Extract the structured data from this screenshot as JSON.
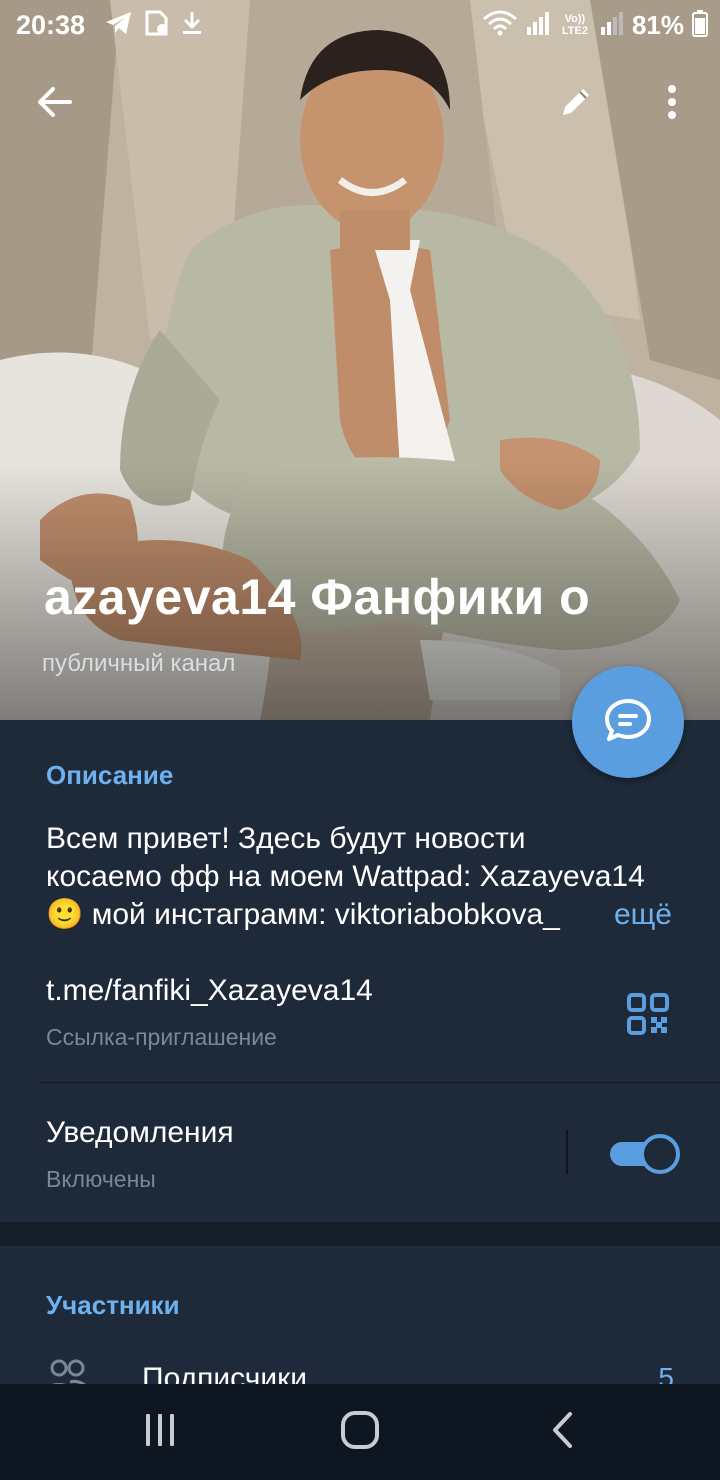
{
  "status_bar": {
    "time": "20:38",
    "battery": "81%",
    "icons_left": [
      "telegram-icon",
      "sim-card-icon",
      "download-icon"
    ],
    "icons_right": [
      "wifi-icon",
      "volte-signal-icon",
      "signal-icon",
      "battery-icon"
    ],
    "volte_label": "Vo)) LTE2"
  },
  "toolbar": {
    "back_icon": "arrow-left-icon",
    "edit_icon": "pencil-icon",
    "more_icon": "dots-vertical-icon"
  },
  "channel": {
    "title": "azayeva14   Фанфики о",
    "subtitle": "публичный канал"
  },
  "info": {
    "description_header": "Описание",
    "description_lines": [
      "Всем привет! Здесь будут новости",
      "косаемо фф на моем Wattpad: Xazayeva14",
      "🙂 мой инстаграмм: viktoriabobkova_"
    ],
    "more_label": "ещё",
    "link": "t.me/fanfiki_Xazayeva14",
    "link_caption": "Ссылка-приглашение",
    "notifications_title": "Уведомления",
    "notifications_status": "Включены",
    "notifications_on": true
  },
  "members": {
    "header": "Участники",
    "subscribers_label": "Подписчики",
    "subscribers_count": "5"
  },
  "colors": {
    "accent": "#5a9ee0",
    "link_blue": "#6fb1ef",
    "panel_bg": "#1e2a3a",
    "nav_bg": "#0e1621"
  }
}
